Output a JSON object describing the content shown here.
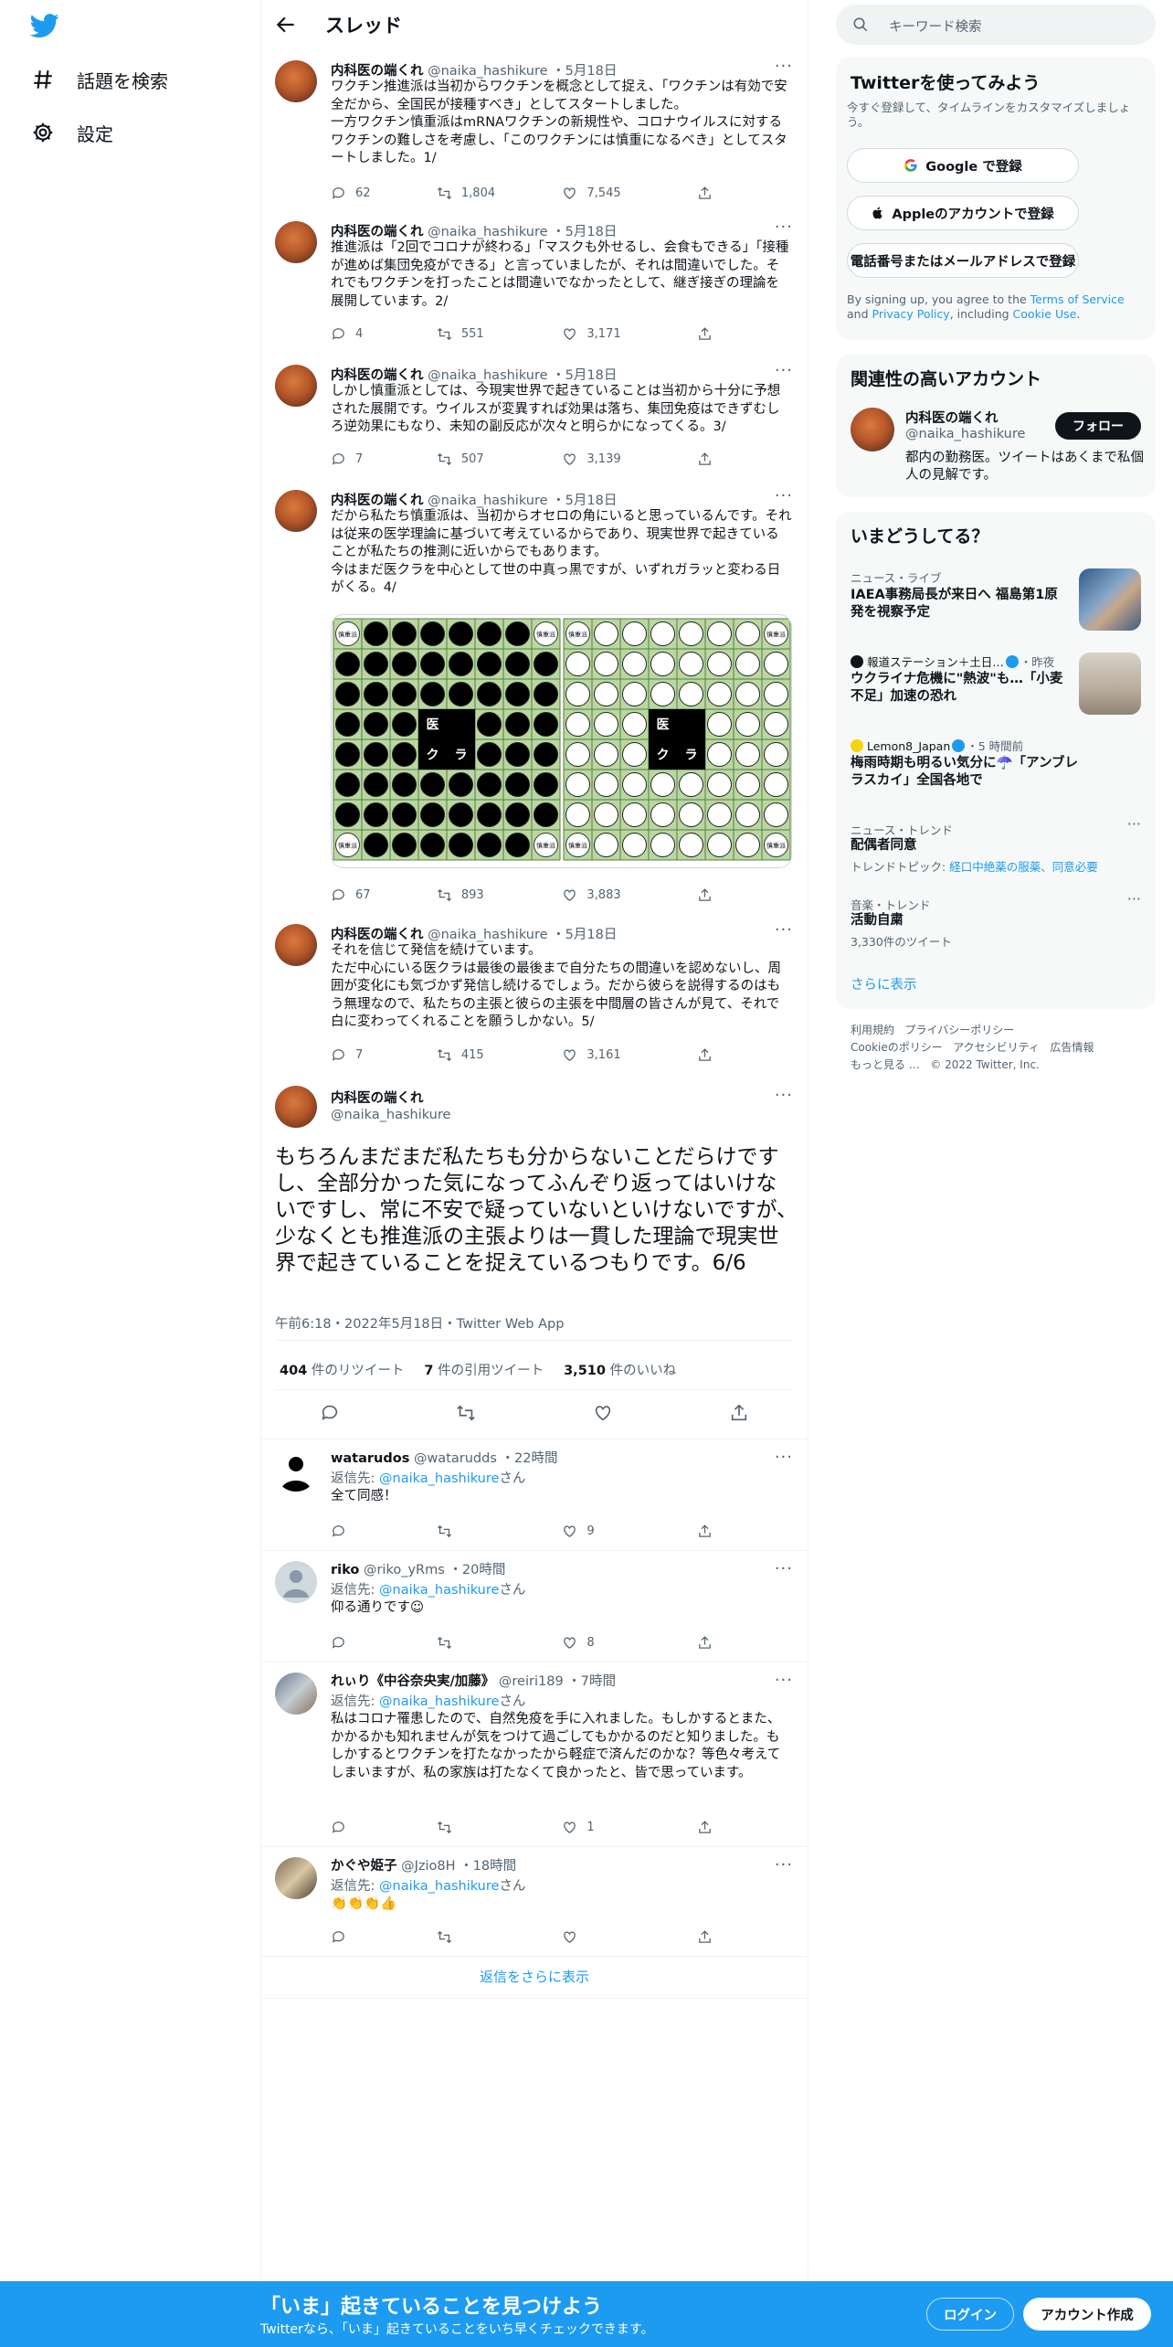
{
  "nav": {
    "explore": "話題を検索",
    "settings": "設定"
  },
  "header": {
    "title": "スレッド"
  },
  "thread": [
    {
      "name": "内科医の端くれ",
      "handle": "@naika_hashikure",
      "date": "5月18日",
      "text": "ワクチン推進派は当初からワクチンを概念として捉え、「ワクチンは有効で安全だから、全国民が接種すべき」としてスタートしました。\n一方ワクチン慎重派はmRNAワクチンの新規性や、コロナウイルスに対するワクチンの難しさを考慮し、「このワクチンには慎重になるべき」としてスタートしました。1/",
      "replies": "62",
      "retweets": "1,804",
      "likes": "7,545"
    },
    {
      "name": "内科医の端くれ",
      "handle": "@naika_hashikure",
      "date": "5月18日",
      "text": "推進派は「2回でコロナが終わる」「マスクも外せるし、会食もできる」「接種が進めば集団免疫ができる」と言っていましたが、それは間違いでした。それでもワクチンを打ったことは間違いでなかったとして、継ぎ接ぎの理論を展開しています。2/",
      "replies": "4",
      "retweets": "551",
      "likes": "3,171"
    },
    {
      "name": "内科医の端くれ",
      "handle": "@naika_hashikure",
      "date": "5月18日",
      "text": "しかし慎重派としては、今現実世界で起きていることは当初から十分に予想された展開です。ウイルスが変異すれば効果は落ち、集団免疫はできずむしろ逆効果にもなり、未知の副反応が次々と明らかになってくる。3/",
      "replies": "7",
      "retweets": "507",
      "likes": "3,139"
    },
    {
      "name": "内科医の端くれ",
      "handle": "@naika_hashikure",
      "date": "5月18日",
      "text": "だから私たち慎重派は、当初からオセロの角にいると思っているんです。それは従来の医学理論に基づいて考えているからであり、現実世界で起きていることが私たちの推測に近いからでもあります。\n今はまだ医クラを中心として世の中真っ黒ですが、いずれガラッと変わる日がくる。4/",
      "replies": "67",
      "retweets": "893",
      "likes": "3,883",
      "board": {
        "left_center": [
          "医",
          "ク",
          "ラ"
        ],
        "corner": "慎重派"
      }
    },
    {
      "name": "内科医の端くれ",
      "handle": "@naika_hashikure",
      "date": "5月18日",
      "text": "それを信じて発信を続けています。\nただ中心にいる医クラは最後の最後まで自分たちの間違いを認めないし、周囲が変化にも気づかず発信し続けるでしょう。だから彼らを説得するのはもう無理なので、私たちの主張と彼らの主張を中間層の皆さんが見て、それで白に変わってくれることを願うしかない。5/",
      "replies": "7",
      "retweets": "415",
      "likes": "3,161"
    }
  ],
  "main_tweet": {
    "name": "内科医の端くれ",
    "handle": "@naika_hashikure",
    "text": "もちろんまだまだ私たちも分からないことだらけですし、全部分かった気になってふんぞり返ってはいけないですし、常に不安で疑っていないといけないですが、少なくとも推進派の主張よりは一貫した理論で現実世界で起きていることを捉えているつもりです。6/6",
    "meta": "午前6:18・2022年5月18日・Twitter Web App",
    "retweets_n": "404",
    "retweets_l": "件のリツイート",
    "quotes_n": "7",
    "quotes_l": "件の引用ツイート",
    "likes_n": "3,510",
    "likes_l": "件のいいね"
  },
  "replies": [
    {
      "name": "watarudos",
      "handle": "@watarudds",
      "time": "22時間",
      "to_prefix": "返信先: ",
      "to": "@naika_hashikure",
      "to_suffix": "さん",
      "text": "全て同感！",
      "replies": "",
      "retweets": "",
      "likes": "9"
    },
    {
      "name": "riko",
      "handle": "@riko_yRms",
      "time": "20時間",
      "to_prefix": "返信先: ",
      "to": "@naika_hashikure",
      "to_suffix": "さん",
      "text": "仰る通りです☺",
      "replies": "",
      "retweets": "",
      "likes": "8"
    },
    {
      "name": "れぃり《中谷奈央実/加藤》",
      "handle": "@reiri189",
      "time": "7時間",
      "to_prefix": "返信先: ",
      "to": "@naika_hashikure",
      "to_suffix": "さん",
      "text": "私はコロナ罹患したので、自然免疫を手に入れました。もしかするとまた、かかるかも知れませんが気をつけて過ごしてもかかるのだと知りました。もしかするとワクチンを打たなかったから軽症で済んだのかな？等色々考えてしまいますが、私の家族は打たなくて良かったと、皆で思っています。",
      "replies": "",
      "retweets": "",
      "likes": "1"
    },
    {
      "name": "かぐや姫子",
      "handle": "@Jzio8H",
      "time": "18時間",
      "to_prefix": "返信先: ",
      "to": "@naika_hashikure",
      "to_suffix": "さん",
      "text": "👏👏👏👍",
      "replies": "",
      "retweets": "",
      "likes": ""
    }
  ],
  "more_replies": "返信をさらに表示",
  "search": {
    "placeholder": "キーワード検索"
  },
  "signup_card": {
    "title": "Twitterを使ってみよう",
    "subtitle": "今すぐ登録して、タイムラインをカスタマイズしましょう。",
    "google": "Google で登録",
    "apple": "Appleのアカウントで登録",
    "phone": "電話番号またはメールアドレスで登録",
    "legal_1": "By signing up, you agree to the ",
    "terms": "Terms of Service",
    "legal_2": " and ",
    "privacy": "Privacy Policy",
    "legal_3": ", including ",
    "cookie": "Cookie Use",
    "legal_4": "."
  },
  "relevant": {
    "title": "関連性の高いアカウント",
    "name": "内科医の端くれ",
    "handle": "@naika_hashikure",
    "bio": "都内の勤務医。ツイートはあくまで私個人の見解です。",
    "follow": "フォロー"
  },
  "trends": {
    "title": "いまどうしてる？",
    "items": [
      {
        "cat": "ニュース・ライブ",
        "title": "IAEA事務局長が来日へ 福島第1原発を視察予定"
      },
      {
        "cat_source": "報道ステーション＋土日…",
        "cat_time": "・昨夜",
        "title": "ウクライナ危機に\"熱波\"も…「小麦不足」加速の恐れ"
      },
      {
        "cat_source": "Lemon8_Japan",
        "cat_time": "・5 時間前",
        "title": "梅雨時期も明るい気分に☂️「アンブレラスカイ」全国各地で"
      },
      {
        "cat": "ニュース・トレンド",
        "title": "配偶者同意",
        "sub_prefix": "トレンドトピック: ",
        "sub_link": "経口中絶薬の服薬、同意必要"
      },
      {
        "cat": "音楽・トレンド",
        "title": "活動自粛",
        "sub": "3,330件のツイート"
      }
    ],
    "show_more": "さらに表示"
  },
  "footer": {
    "line1": [
      "利用規約",
      "プライバシーポリシー"
    ],
    "line2": [
      "Cookieのポリシー",
      "アクセシビリティ",
      "広告情報"
    ],
    "line3": [
      "もっと見る …",
      "© 2022 Twitter, Inc."
    ]
  },
  "bottom_bar": {
    "headline": "「いま」起きていることを見つけよう",
    "sub": "Twitterなら、「いま」起きていることをいち早くチェックできます。",
    "login": "ログイン",
    "signup": "アカウント作成"
  },
  "colors": {
    "accent": "#1d9bf0",
    "text": "#0f1419",
    "muted": "#536471",
    "board_green": "#b8d8a0"
  }
}
